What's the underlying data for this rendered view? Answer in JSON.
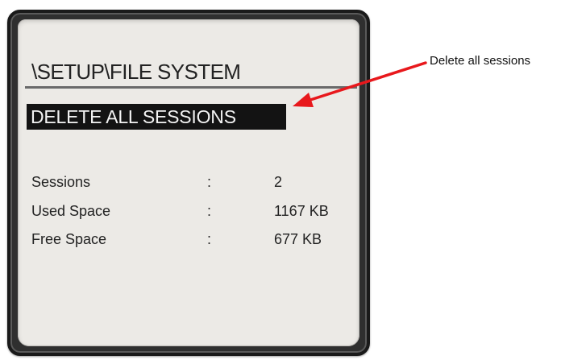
{
  "screen": {
    "path_title": "\\SETUP\\FILE SYSTEM",
    "selected_item": "DELETE ALL SESSIONS",
    "rows": [
      {
        "label": "Sessions",
        "separator": ":",
        "value": "2"
      },
      {
        "label": "Used Space",
        "separator": ":",
        "value": "1167 KB"
      },
      {
        "label": "Free Space",
        "separator": ":",
        "value": "677 KB"
      }
    ]
  },
  "annotation": {
    "text": "Delete all sessions",
    "arrow_color": "#e8181c"
  },
  "colors": {
    "screen_background": "#eceae6",
    "highlight_background": "#131313",
    "highlight_text": "#f3f3f3",
    "bezel": "#2f2f2f"
  }
}
